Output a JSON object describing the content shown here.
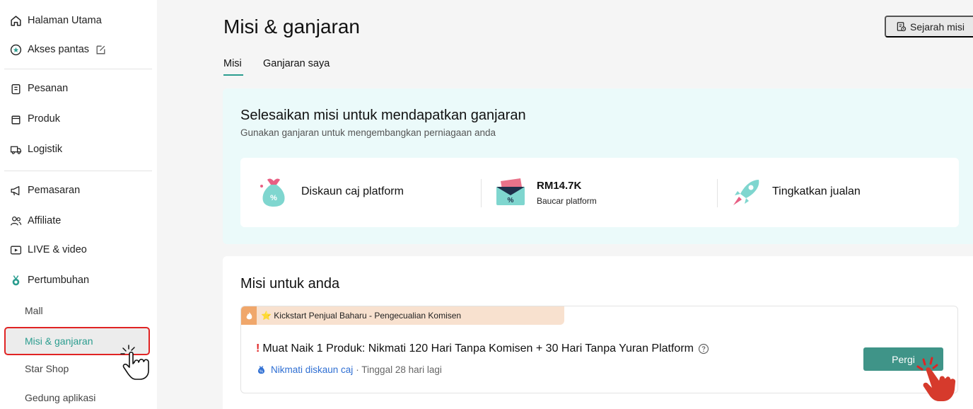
{
  "sidebar": {
    "items": [
      {
        "label": "Halaman Utama",
        "icon": "home-icon"
      },
      {
        "label": "Akses pantas",
        "icon": "star-circle-icon"
      },
      {
        "label": "Pesanan",
        "icon": "clipboard-icon"
      },
      {
        "label": "Produk",
        "icon": "bag-icon"
      },
      {
        "label": "Logistik",
        "icon": "truck-icon"
      },
      {
        "label": "Pemasaran",
        "icon": "megaphone-icon"
      },
      {
        "label": "Affiliate",
        "icon": "people-icon"
      },
      {
        "label": "LIVE & video",
        "icon": "video-icon"
      },
      {
        "label": "Pertumbuhan",
        "icon": "medal-icon"
      }
    ],
    "sub_items": [
      "Mall",
      "Misi & ganjaran",
      "Star Shop",
      "Gedung aplikasi"
    ],
    "active": "Misi & ganjaran"
  },
  "header": {
    "title": "Misi & ganjaran",
    "history_button": "Sejarah misi"
  },
  "tabs": [
    {
      "label": "Misi",
      "active": true
    },
    {
      "label": "Ganjaran saya",
      "active": false
    }
  ],
  "banner": {
    "title": "Selesaikan misi untuk mendapatkan ganjaran",
    "subtitle": "Gunakan ganjaran untuk mengembangkan perniagaan anda",
    "rewards": [
      {
        "label": "Diskaun caj platform"
      },
      {
        "value": "RM14.7K",
        "sub": "Baucar platform"
      },
      {
        "label": "Tingkatkan jualan"
      }
    ]
  },
  "missions": {
    "heading": "Misi untuk anda",
    "card": {
      "tag": "⭐ Kickstart Penjual Baharu - Pengecualian Komisen",
      "title": "Muat Naik 1 Produk: Nikmati 120 Hari Tanpa Komisen + 30 Hari Tanpa Yuran Platform",
      "reward_link": "Nikmati diskaun caj",
      "remaining": "· Tinggal 28 hari lagi",
      "button": "Pergi"
    }
  },
  "colors": {
    "accent": "#2b9d8f",
    "button": "#3f9488",
    "highlight_border": "#e02424",
    "link": "#2f6fd3"
  }
}
